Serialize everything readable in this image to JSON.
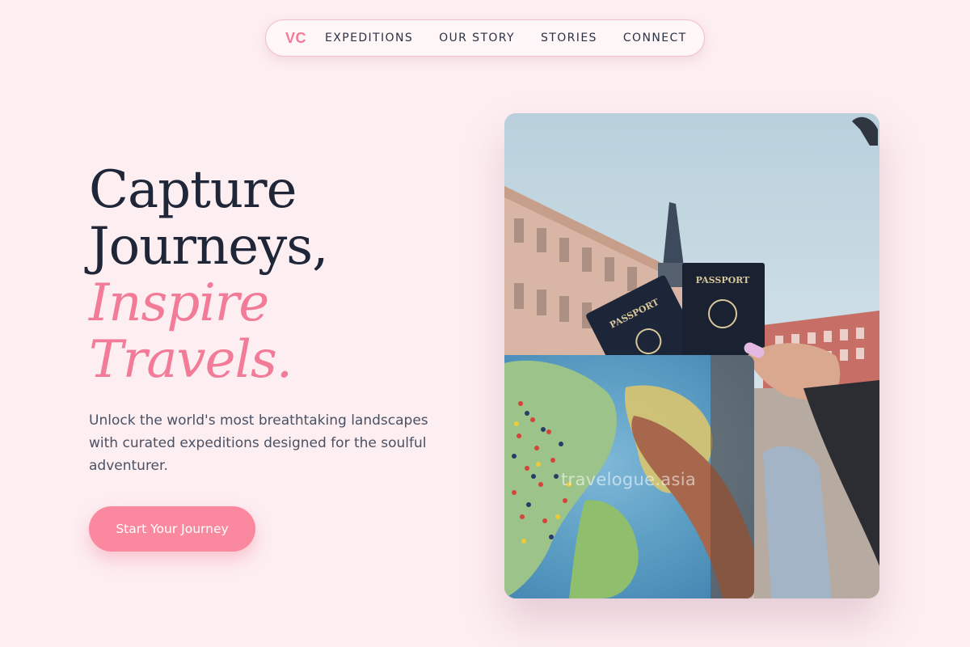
{
  "nav": {
    "logo": "VC",
    "links": [
      "EXPEDITIONS",
      "OUR STORY",
      "STORIES",
      "CONNECT"
    ]
  },
  "hero": {
    "line1": "Capture",
    "line2": "Journeys,",
    "line3": "Inspire",
    "line4": "Travels.",
    "subtitle": "Unlock the world's most breathtaking landscapes with curated expeditions designed for the soulful adventurer.",
    "cta_label": "Start Your Journey"
  },
  "photo": {
    "passport_label": "PASSPORT",
    "watermark": "travelogue.asia"
  },
  "colors": {
    "background": "#fdeef1",
    "accent_pink": "#f27b97",
    "button_pink": "#fa889f",
    "heading_dark": "#1e2638"
  }
}
